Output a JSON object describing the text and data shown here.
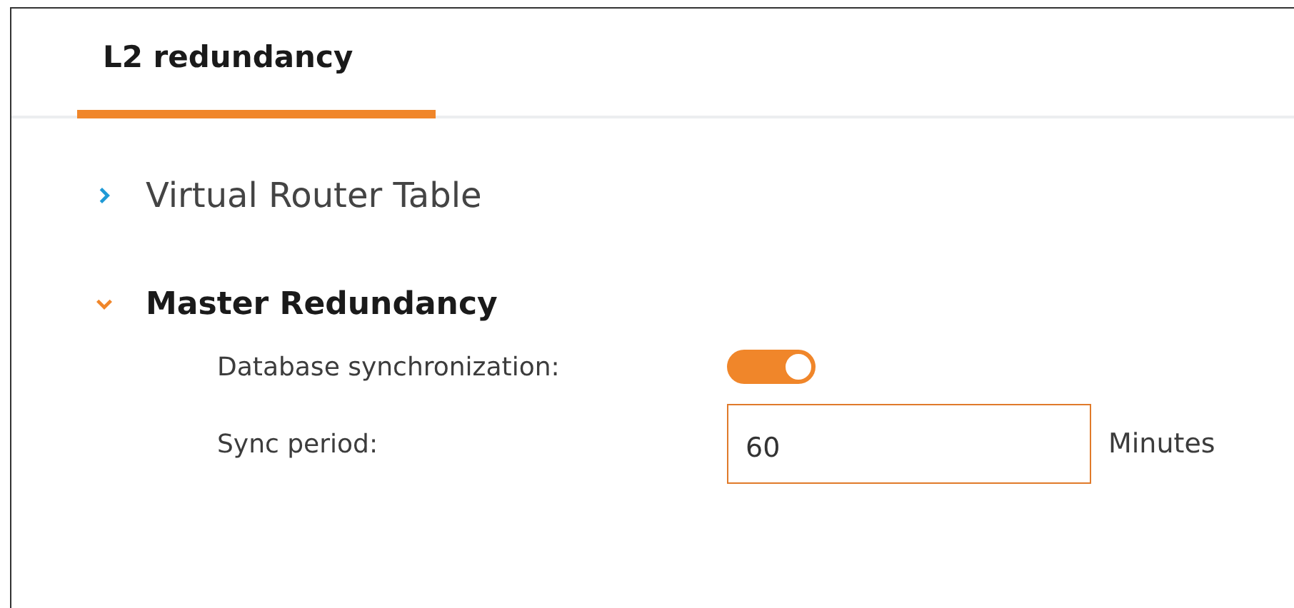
{
  "tabs": [
    {
      "label": "L2 redundancy",
      "selected": true
    }
  ],
  "sections": [
    {
      "title": "Virtual Router Table",
      "expanded": false
    },
    {
      "title": "Master Redundancy",
      "expanded": true,
      "fields": [
        {
          "kind": "toggle",
          "label": "Database synchronization:",
          "on": true
        },
        {
          "kind": "input",
          "label": "Sync period:",
          "value": "60",
          "unit": "Minutes"
        }
      ]
    }
  ]
}
